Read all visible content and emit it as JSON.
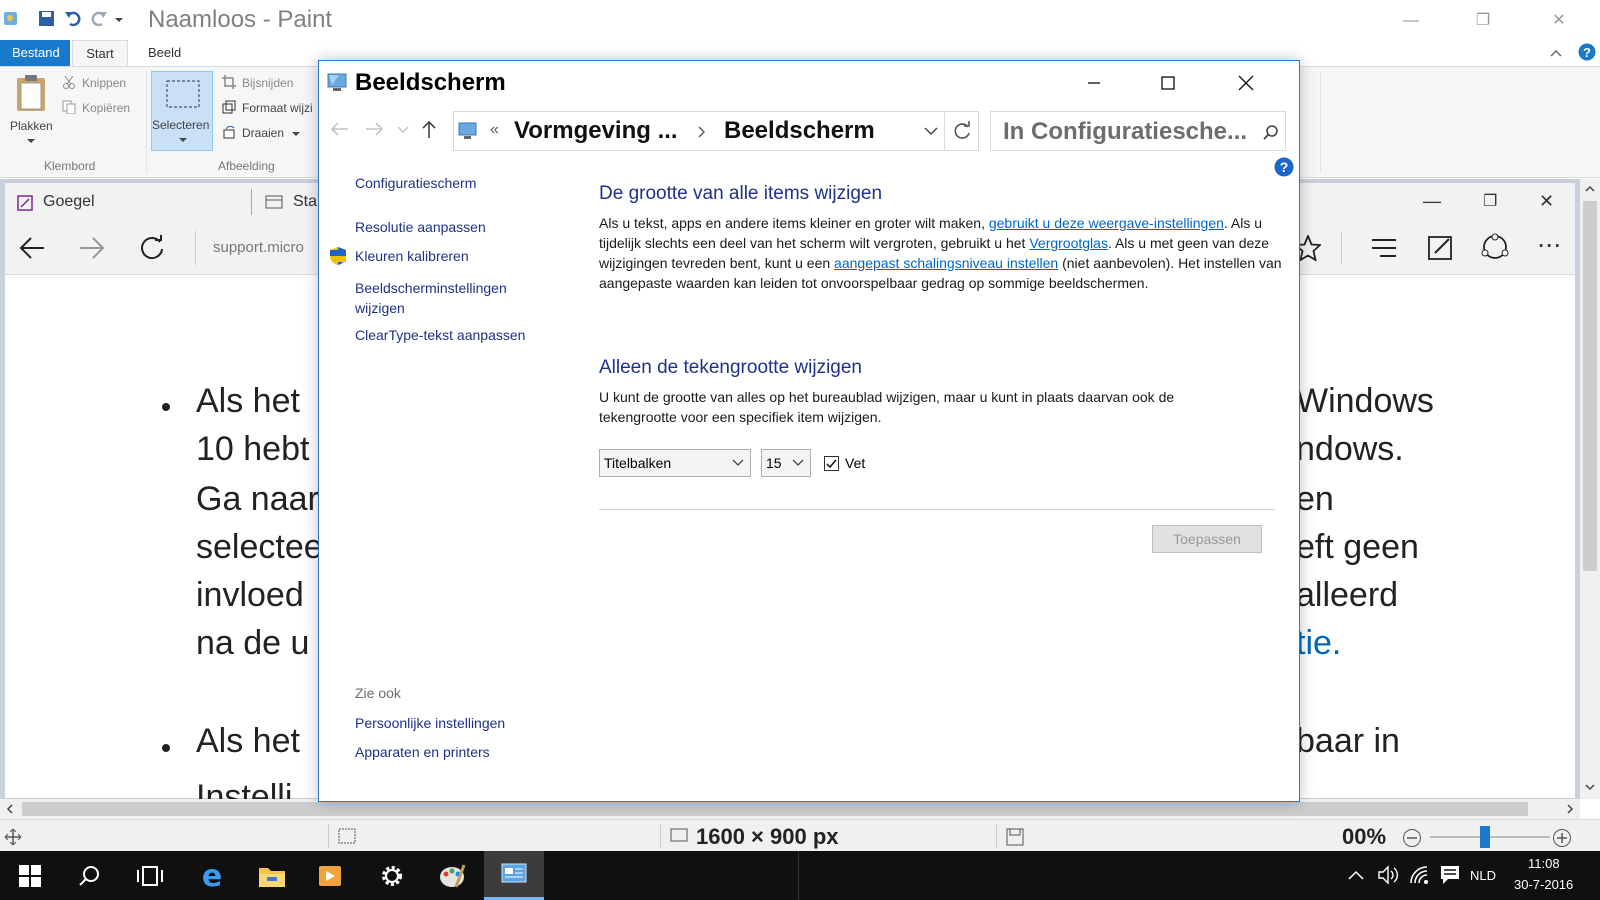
{
  "paint": {
    "title": "Naamloos - Paint",
    "tabs": [
      "Bestand",
      "Start",
      "Beeld"
    ],
    "ribbon": {
      "paste": "Plakken",
      "cut": "Knippen",
      "copy": "Kopiëren",
      "clipboard_group": "Klembord",
      "select": "Selecteren",
      "crop": "Bijsnijden",
      "resize": "Formaat wijzi",
      "rotate": "Draaien",
      "image_group": "Afbeelding"
    },
    "status": {
      "size": "1600 × 900 px",
      "zoom": "00%"
    }
  },
  "edge": {
    "tab1": "Goegel",
    "tab2": "Star",
    "address": "support.micro",
    "address_bold": "micro",
    "left_lines": [
      "Als het",
      "10 hebt",
      "Ga naar",
      "selectee",
      "invloed",
      "na de u",
      "Als het",
      "Instelli"
    ],
    "right_lines": [
      "Windows",
      "ndows.",
      "en",
      "eft geen",
      "alleerd",
      "tie.",
      "baar in"
    ]
  },
  "dialog": {
    "title": "Beeldscherm",
    "breadcrumb_parent": "Vormgeving ...",
    "breadcrumb_current": "Beeldscherm",
    "breadcrumb_sep": "«",
    "search_placeholder": "In Configuratiesche...",
    "sidebar": {
      "home": "Configuratiescherm",
      "links": [
        "Resolutie aanpassen",
        "Kleuren kalibreren",
        "Beeldscherminstellingen wijzigen",
        "ClearType-tekst aanpassen"
      ],
      "see_also": "Zie ook",
      "see_also_links": [
        "Persoonlijke instellingen",
        "Apparaten en printers"
      ]
    },
    "section1": {
      "title": "De grootte van alle items wijzigen",
      "p1_before": "Als u tekst, apps en andere items kleiner en groter wilt maken, ",
      "p1_link1": "gebruikt u deze weergave-instellingen",
      "p1_mid1": ". Als u tijdelijk slechts een deel van het scherm wilt vergroten, gebruikt u het ",
      "p1_link2": "Vergrootglas",
      "p1_mid2": ". Als u met geen van deze wijzigingen tevreden bent, kunt u een ",
      "p1_link3": "aangepast schalingsniveau instellen",
      "p1_after": " (niet aanbevolen). Het instellen van aangepaste waarden kan leiden tot onvoorspelbaar gedrag op sommige beeldschermen."
    },
    "section2": {
      "title": "Alleen de tekengrootte wijzigen",
      "text": "U kunt de grootte van alles op het bureaublad wijzigen, maar u kunt in plaats daarvan ook de tekengrootte voor een specifiek item wijzigen.",
      "item_select": "Titelbalken",
      "size_select": "15",
      "bold_label": "Vet",
      "bold_checked": true,
      "apply": "Toepassen"
    }
  },
  "taskbar": {
    "language": "NLD",
    "time": "11:08",
    "date": "30-7-2016"
  },
  "colors": {
    "accent": "#1979ca",
    "link": "#0066cc",
    "heading": "#1e3287",
    "taskbar": "#101010"
  }
}
